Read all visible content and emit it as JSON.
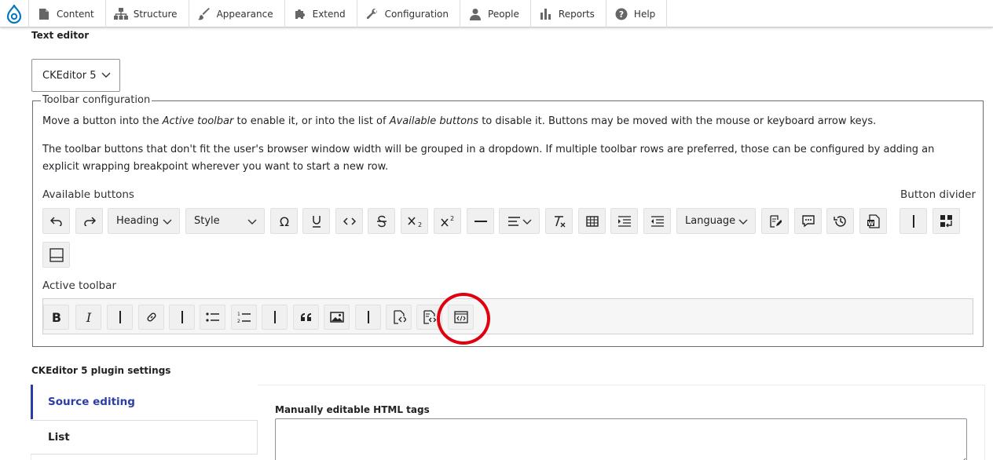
{
  "admin_menu": {
    "logo_icon": "drupal-drop-icon",
    "items": [
      {
        "label": "Content",
        "icon": "page-icon"
      },
      {
        "label": "Structure",
        "icon": "sitemap-icon"
      },
      {
        "label": "Appearance",
        "icon": "paintbrush-icon"
      },
      {
        "label": "Extend",
        "icon": "puzzle-icon"
      },
      {
        "label": "Configuration",
        "icon": "wrench-icon"
      },
      {
        "label": "People",
        "icon": "person-icon"
      },
      {
        "label": "Reports",
        "icon": "bar-chart-icon"
      },
      {
        "label": "Help",
        "icon": "question-icon"
      }
    ]
  },
  "text_editor": {
    "label": "Text editor",
    "selected_value": "CKEditor 5"
  },
  "toolbar_config": {
    "legend": "Toolbar configuration",
    "desc1_part1": "Move a button into the ",
    "desc1_em1": "Active toolbar",
    "desc1_part2": " to enable it, or into the list of ",
    "desc1_em2": "Available buttons",
    "desc1_part3": " to disable it. Buttons may be moved with the mouse or keyboard arrow keys.",
    "desc2": "The toolbar buttons that don't fit the user's browser window width will be grouped in a dropdown. If multiple toolbar rows are preferred, those can be configured by adding an explicit wrapping breakpoint wherever you want to start a new row.",
    "available_label": "Available buttons",
    "divider_label": "Button divider",
    "active_label": "Active toolbar",
    "heading_label": "Heading",
    "style_label": "Style",
    "language_label": "Language"
  },
  "plugin_settings": {
    "label": "CKEditor 5 plugin settings",
    "tabs": [
      "Source editing",
      "List"
    ],
    "html_tags_label": "Manually editable HTML tags",
    "html_tags_value": ""
  },
  "colors": {
    "accent": "#2b3ea7",
    "highlight": "#e00010",
    "drupal_blue": "#0678be"
  }
}
